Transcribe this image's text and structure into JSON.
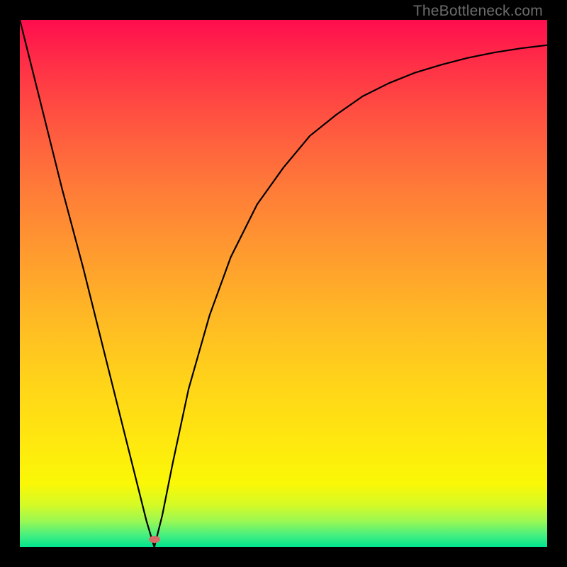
{
  "watermark": "TheBottleneck.com",
  "marker": {
    "x_pct": 25.5,
    "y_from_bottom_pct": 1.5
  },
  "chart_data": {
    "type": "line",
    "title": "",
    "xlabel": "",
    "ylabel": "",
    "xlim": [
      0,
      100
    ],
    "ylim": [
      0,
      100
    ],
    "grid": false,
    "legend": false,
    "note": "V-shaped bottleneck curve with minimum near x≈25; background gradient red→green indicates high→low bottleneck.",
    "series": [
      {
        "name": "bottleneck-curve",
        "x": [
          0,
          4,
          8,
          12,
          16,
          20,
          22,
          24,
          25.5,
          27,
          29,
          32,
          36,
          40,
          45,
          50,
          55,
          60,
          65,
          70,
          75,
          80,
          85,
          90,
          95,
          100
        ],
        "y": [
          100,
          84,
          68,
          53,
          37,
          21,
          13,
          5,
          0,
          6,
          16,
          30,
          44,
          55,
          65,
          72,
          78,
          82,
          85.5,
          88,
          90,
          91.5,
          92.8,
          93.8,
          94.6,
          95.2
        ]
      }
    ]
  }
}
